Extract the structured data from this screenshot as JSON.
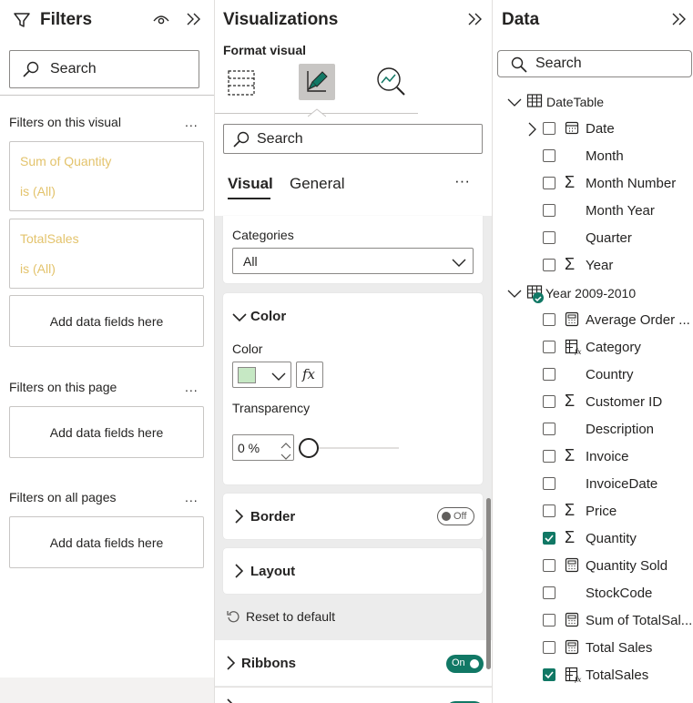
{
  "filters": {
    "title": "Filters",
    "search_placeholder": "Search",
    "on_visual_header": "Filters on this visual",
    "visual_filters": [
      {
        "name": "Sum of Quantity",
        "value": "is (All)"
      },
      {
        "name": "TotalSales",
        "value": "is (All)"
      }
    ],
    "add_fields_label": "Add data fields here",
    "on_page_header": "Filters on this page",
    "on_all_pages_header": "Filters on all pages",
    "more": "..."
  },
  "visualizations": {
    "title": "Visualizations",
    "format_visual_label": "Format visual",
    "search_placeholder": "Search",
    "tabs": [
      "Visual",
      "General"
    ],
    "more": "···",
    "categories_label": "Categories",
    "categories_value": "All",
    "color_section": "Color",
    "color_label": "Color",
    "fx_label": "fx",
    "swatch_color": "#c6e8c4",
    "transparency_label": "Transparency",
    "transparency_value": "0 %",
    "transparency_level": 0,
    "border_section": "Border",
    "border_toggle": "Off",
    "layout_section": "Layout",
    "reset_label": "Reset to default",
    "ribbons_section": "Ribbons",
    "ribbons_toggle": "On"
  },
  "data": {
    "title": "Data",
    "search_placeholder": "Search",
    "tables": [
      {
        "name": "DateTable",
        "fields": [
          {
            "label": "Date",
            "icon": "calendar-icon",
            "checked": false,
            "expandable": true
          },
          {
            "label": "Month",
            "icon": "",
            "checked": false
          },
          {
            "label": "Month Number",
            "icon": "sigma-icon",
            "checked": false
          },
          {
            "label": "Month Year",
            "icon": "",
            "checked": false
          },
          {
            "label": "Quarter",
            "icon": "",
            "checked": false
          },
          {
            "label": "Year",
            "icon": "sigma-icon",
            "checked": false
          }
        ]
      },
      {
        "name": "Year 2009-2010",
        "fields": [
          {
            "label": "Average Order ...",
            "icon": "calculator-icon",
            "checked": false
          },
          {
            "label": "Category",
            "icon": "calculated-column-icon",
            "checked": false
          },
          {
            "label": "Country",
            "icon": "",
            "checked": false
          },
          {
            "label": "Customer ID",
            "icon": "sigma-icon",
            "checked": false
          },
          {
            "label": "Description",
            "icon": "",
            "checked": false
          },
          {
            "label": "Invoice",
            "icon": "sigma-icon",
            "checked": false
          },
          {
            "label": "InvoiceDate",
            "icon": "",
            "checked": false
          },
          {
            "label": "Price",
            "icon": "sigma-icon",
            "checked": false
          },
          {
            "label": "Quantity",
            "icon": "sigma-icon",
            "checked": true
          },
          {
            "label": "Quantity Sold",
            "icon": "calculator-icon",
            "checked": false
          },
          {
            "label": "StockCode",
            "icon": "",
            "checked": false
          },
          {
            "label": "Sum of TotalSal...",
            "icon": "calculator-icon",
            "checked": false
          },
          {
            "label": "Total Sales",
            "icon": "calculator-icon",
            "checked": false
          },
          {
            "label": "TotalSales",
            "icon": "calculated-column-icon",
            "checked": true
          }
        ]
      }
    ]
  },
  "colors": {
    "accent": "#117865",
    "filter_text": "#e3c36c",
    "panel_bg": "#ececec"
  }
}
